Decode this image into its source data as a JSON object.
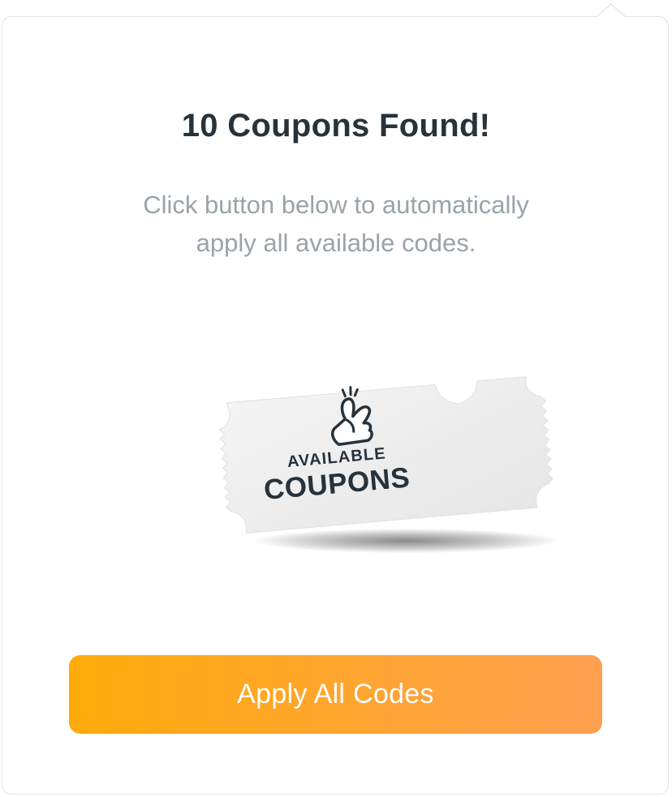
{
  "popup": {
    "title": "10 Coupons Found!",
    "subtitle_line1": "Click button below to automatically",
    "subtitle_line2": "apply all available codes."
  },
  "ticket": {
    "label_top": "AVAILABLE",
    "label_bottom": "COUPONS",
    "icon": "crossed-fingers-icon"
  },
  "actions": {
    "apply_label": "Apply All Codes"
  },
  "colors": {
    "title": "#27323a",
    "subtitle": "#9aa3a8",
    "button_start": "#ffaa0a",
    "button_end": "#ffa050",
    "border": "#e3e5e6"
  }
}
